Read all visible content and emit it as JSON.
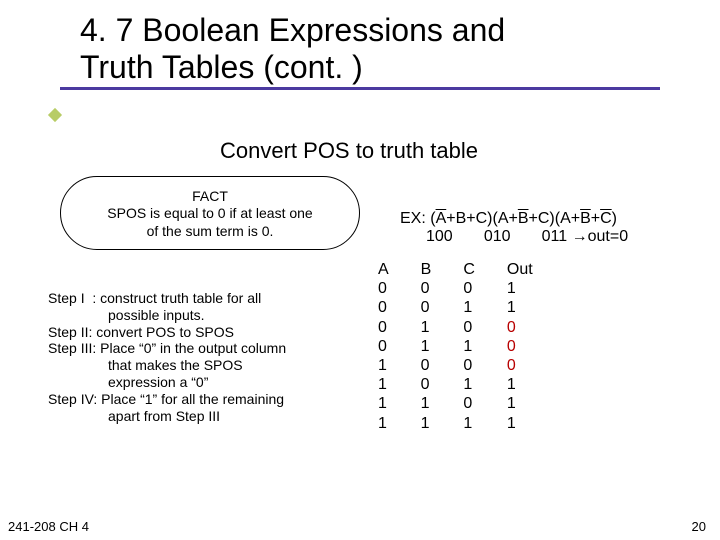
{
  "title_l1": "4. 7 Boolean Expressions and",
  "title_l2": "Truth Tables (cont. )",
  "subtitle": "Convert POS to truth table",
  "fact": {
    "l1": "FACT",
    "l2": "SPOS is equal to 0 if at least one",
    "l3": "of the sum term is 0."
  },
  "steps": {
    "s1a": "Step I  : construct truth table for all",
    "s1b": "possible inputs.",
    "s2": "Step II: convert POS to SPOS",
    "s3a": "Step III: Place “0” in the output column",
    "s3b": "that makes the SPOS",
    "s3c": "expression a “0”",
    "s4a": "Step IV: Place “1” for all the remaining",
    "s4b": "apart from Step III"
  },
  "ex": {
    "prefix": "EX: (",
    "A": "A",
    "B": "B",
    "C": "C",
    "plus": "+",
    "close": ")",
    "open": "(",
    "l2_100": "100",
    "l2_010": "010",
    "l2_011": "011 ",
    "l2_arrow": "→out=0"
  },
  "truth": {
    "headers": [
      "A",
      "B",
      "C",
      "Out"
    ],
    "rows": [
      {
        "a": "0",
        "b": "0",
        "c": "0",
        "out": "1",
        "zero": false
      },
      {
        "a": "0",
        "b": "0",
        "c": "1",
        "out": "1",
        "zero": false
      },
      {
        "a": "0",
        "b": "1",
        "c": "0",
        "out": "0",
        "zero": true
      },
      {
        "a": "0",
        "b": "1",
        "c": "1",
        "out": "0",
        "zero": true
      },
      {
        "a": "1",
        "b": "0",
        "c": "0",
        "out": "0",
        "zero": true
      },
      {
        "a": "1",
        "b": "0",
        "c": "1",
        "out": "1",
        "zero": false
      },
      {
        "a": "1",
        "b": "1",
        "c": "0",
        "out": "1",
        "zero": false
      },
      {
        "a": "1",
        "b": "1",
        "c": "1",
        "out": "1",
        "zero": false
      }
    ]
  },
  "footer_left": "241-208 CH 4",
  "footer_right": "20",
  "chart_data": {
    "type": "table",
    "title": "POS truth table for (A'+B+C)(A+B'+C)(A+B'+C')",
    "columns": [
      "A",
      "B",
      "C",
      "Out"
    ],
    "rows": [
      [
        0,
        0,
        0,
        1
      ],
      [
        0,
        0,
        1,
        1
      ],
      [
        0,
        1,
        0,
        0
      ],
      [
        0,
        1,
        1,
        0
      ],
      [
        1,
        0,
        0,
        0
      ],
      [
        1,
        0,
        1,
        1
      ],
      [
        1,
        1,
        0,
        1
      ],
      [
        1,
        1,
        1,
        1
      ]
    ]
  }
}
